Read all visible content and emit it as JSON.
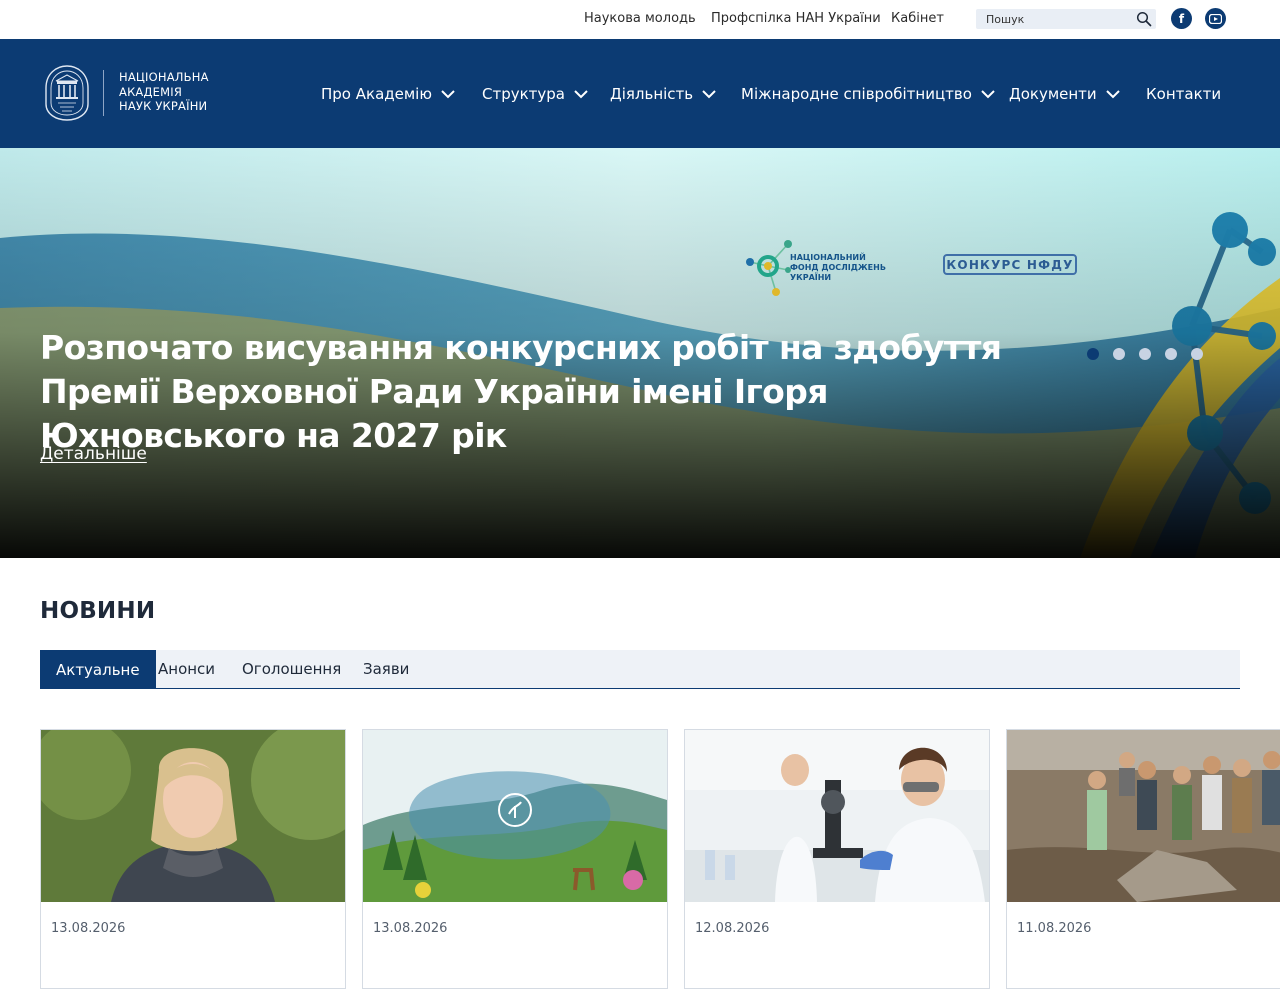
{
  "top_links": [
    "Наукова молодь",
    "Профспілка НАН України",
    "Кабінет"
  ],
  "search": {
    "placeholder": "Пошук"
  },
  "social": {
    "facebook": "f",
    "youtube": "▶"
  },
  "logo": {
    "lines": [
      "НАЦІОНАЛЬНА",
      "АКАДЕМІЯ",
      "НАУК УКРАЇНИ"
    ]
  },
  "nav": [
    {
      "label": "Про Академію",
      "has_dropdown": true
    },
    {
      "label": "Структура",
      "has_dropdown": true
    },
    {
      "label": "Діяльність",
      "has_dropdown": true
    },
    {
      "label": "Міжнародне співробітництво",
      "has_dropdown": true
    },
    {
      "label": "Документи",
      "has_dropdown": true
    },
    {
      "label": "Контакти",
      "has_dropdown": false
    }
  ],
  "hero": {
    "title": "Розпочато висування конкурсних робіт на здобуття Премії Верховної Ради України імені Ігоря Юхновського на 2027 рік",
    "link": "Детальніше",
    "nfdu_lines": [
      "НАЦІОНАЛЬНИЙ",
      "ФОНД ДОСЛІДЖЕНЬ",
      "УКРАЇНИ"
    ],
    "contest_badge": "КОНКУРС НФДУ",
    "slides_total": 5,
    "active_slide": 1
  },
  "news": {
    "heading": "НОВИНИ",
    "tabs": [
      "Актуальне",
      "Анонси",
      "Оголошення",
      "Заяви"
    ],
    "active_tab": 0,
    "cards": [
      {
        "date": "13.08.2026",
        "image": "portrait of a woman"
      },
      {
        "date": "13.08.2026",
        "image": "nature landscape with map of Ukraine"
      },
      {
        "date": "12.08.2026",
        "image": "scientist with microscope in laboratory"
      },
      {
        "date": "11.08.2026",
        "image": "group of archaeologists at excavation site"
      }
    ]
  },
  "colors": {
    "brand_navy": "#0c3b73",
    "tab_bg": "#eef2f7",
    "dot_inactive": "#c8d3e3"
  }
}
